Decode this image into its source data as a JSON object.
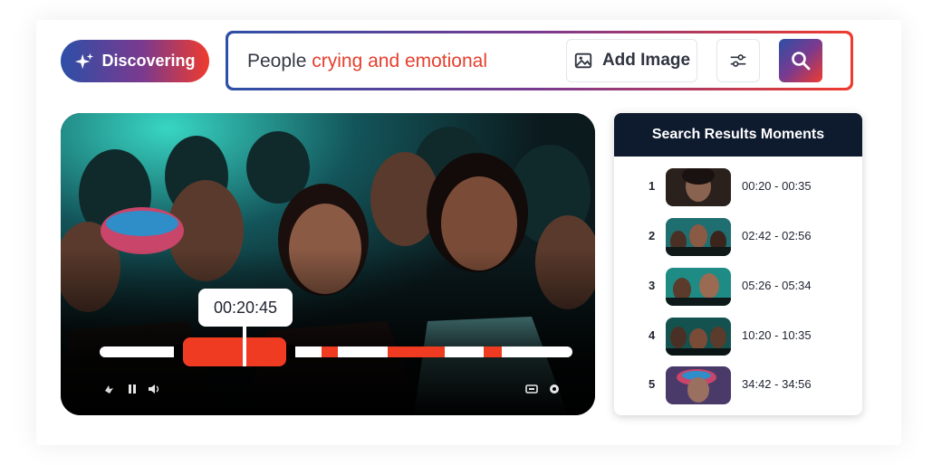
{
  "discover": {
    "label": "Discovering",
    "icon": "sparkle-icon"
  },
  "search": {
    "query_plain": "People",
    "query_highlight": "crying and emotional",
    "add_image_label": "Add Image",
    "add_image_icon": "image-icon",
    "filter_icon": "sliders-icon",
    "search_icon": "search-icon"
  },
  "player": {
    "timecode": "00:20:45",
    "controls": [
      "volume-icon",
      "pause-icon",
      "speaker-icon",
      "captions-icon",
      "settings-icon"
    ]
  },
  "results": {
    "title": "Search Results Moments",
    "items": [
      {
        "num": "1",
        "time": "00:20 - 00:35"
      },
      {
        "num": "2",
        "time": "02:42 - 02:56"
      },
      {
        "num": "3",
        "time": "05:26 - 05:34"
      },
      {
        "num": "4",
        "time": "10:20 - 10:35"
      },
      {
        "num": "5",
        "time": "34:42 - 34:56"
      }
    ]
  },
  "colors": {
    "accent_red": "#ef3b21",
    "accent_blue": "#2d4fa7",
    "header_navy": "#0e1a2e"
  }
}
